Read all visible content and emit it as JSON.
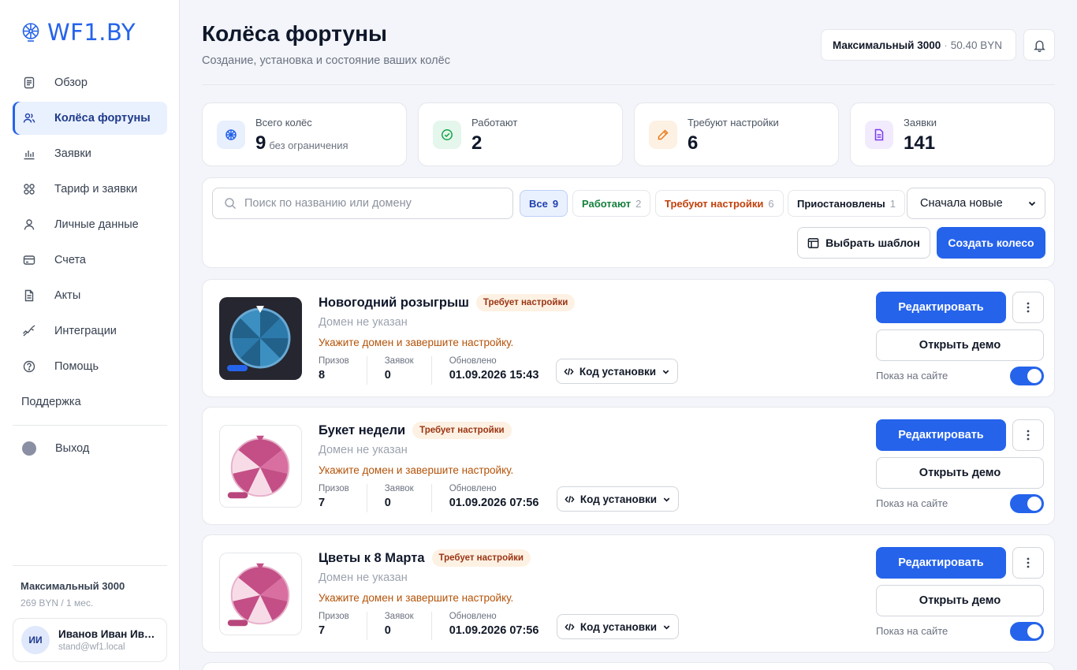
{
  "brand": {
    "name": "WF1.BY",
    "accent": "#2563eb"
  },
  "sidebar": {
    "items": [
      {
        "label": "Обзор",
        "icon": "document-icon"
      },
      {
        "label": "Колёса фортуны",
        "icon": "users-icon",
        "active": true
      },
      {
        "label": "Заявки",
        "icon": "bar-chart-icon"
      },
      {
        "label": "Тариф и заявки",
        "icon": "grid-icon"
      },
      {
        "label": "Личные данные",
        "icon": "user-icon"
      },
      {
        "label": "Счета",
        "icon": "card-icon"
      },
      {
        "label": "Акты",
        "icon": "file-icon"
      },
      {
        "label": "Интеграции",
        "icon": "link-icon"
      },
      {
        "label": "Помощь",
        "icon": "help-icon"
      }
    ],
    "support_label": "Поддержка",
    "logout_label": "Выход",
    "plan_name": "Максимальный 3000",
    "plan_price": "269 BYN / 1 мес.",
    "user": {
      "initials": "ИИ",
      "name": "Иванов Иван Иванович",
      "email": "stand@wf1.local"
    }
  },
  "header": {
    "title": "Колёса фортуны",
    "subtitle": "Создание, установка и состояние ваших колёс",
    "plan_name": "Максимальный 3000",
    "separator": "·",
    "balance": "50.40 BYN"
  },
  "stats": [
    {
      "label": "Всего колёс",
      "value": "9",
      "note": "без ограничения",
      "icon": "wheel-icon",
      "color": "#2563eb",
      "bg": "#e8effd"
    },
    {
      "label": "Работают",
      "value": "2",
      "note": "",
      "icon": "check-circle-icon",
      "color": "#16a34a",
      "bg": "#e5f6ec"
    },
    {
      "label": "Требуют настройки",
      "value": "6",
      "note": "",
      "icon": "pencil-icon",
      "color": "#ea7a1b",
      "bg": "#fdf1e3"
    },
    {
      "label": "Заявки",
      "value": "141",
      "note": "",
      "icon": "document-icon",
      "color": "#7c3aed",
      "bg": "#f1ebfd"
    }
  ],
  "filters": {
    "search_placeholder": "Поиск по названию или домену",
    "chips": [
      {
        "label": "Все",
        "count": "9",
        "color": "#1e40af"
      },
      {
        "label": "Работают",
        "count": "2",
        "color": "#15803d"
      },
      {
        "label": "Требуют настройки",
        "count": "6",
        "color": "#c2410c"
      },
      {
        "label": "Приостановлены",
        "count": "1",
        "color": "#111827"
      }
    ],
    "sort_value": "Сначала новые",
    "template_button": "Выбрать шаблон",
    "create_button": "Создать колесо"
  },
  "wheels": [
    {
      "name": "Новогодний розыгрыш",
      "status": "Требует настройки",
      "domain": "Домен не указан",
      "warning": "Укажите домен и завершите настройку.",
      "prizes_label": "Призов",
      "prizes": "8",
      "leads_label": "Заявок",
      "leads": "0",
      "updated_label": "Обновлено",
      "updated": "01.09.2026 15:43",
      "code_button": "Код установки",
      "edit_button": "Редактировать",
      "demo_button": "Открыть демо",
      "show_label": "Показ на сайте",
      "show_on_site": true,
      "theme": "dark"
    },
    {
      "name": "Букет недели",
      "status": "Требует настройки",
      "domain": "Домен не указан",
      "warning": "Укажите домен и завершите настройку.",
      "prizes_label": "Призов",
      "prizes": "7",
      "leads_label": "Заявок",
      "leads": "0",
      "updated_label": "Обновлено",
      "updated": "01.09.2026 07:56",
      "code_button": "Код установки",
      "edit_button": "Редактировать",
      "demo_button": "Открыть демо",
      "show_label": "Показ на сайте",
      "show_on_site": true,
      "theme": "pink"
    },
    {
      "name": "Цветы к 8 Марта",
      "status": "Требует настройки",
      "domain": "Домен не указан",
      "warning": "Укажите домен и завершите настройку.",
      "prizes_label": "Призов",
      "prizes": "7",
      "leads_label": "Заявок",
      "leads": "0",
      "updated_label": "Обновлено",
      "updated": "01.09.2026 07:56",
      "code_button": "Код установки",
      "edit_button": "Редактировать",
      "demo_button": "Открыть демо",
      "show_label": "Показ на сайте",
      "show_on_site": true,
      "theme": "pink"
    }
  ]
}
